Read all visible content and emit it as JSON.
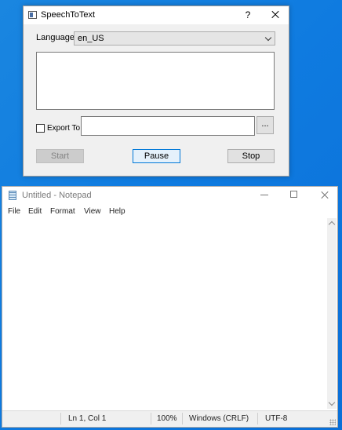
{
  "dialog": {
    "title": "SpeechToText",
    "help_label": "?",
    "language_label": "Language",
    "language_value": "en_US",
    "export_label": "Export To",
    "export_value": "",
    "browse_label": "...",
    "start_label": "Start",
    "pause_label": "Pause",
    "stop_label": "Stop"
  },
  "notepad": {
    "title": "Untitled - Notepad",
    "menus": [
      "File",
      "Edit",
      "Format",
      "View",
      "Help"
    ],
    "status": {
      "position": "Ln 1, Col 1",
      "zoom": "100%",
      "line_ending": "Windows (CRLF)",
      "encoding": "UTF-8"
    }
  },
  "colors": {
    "desktop": "#0f7be0",
    "focus_border": "#0078d7"
  }
}
